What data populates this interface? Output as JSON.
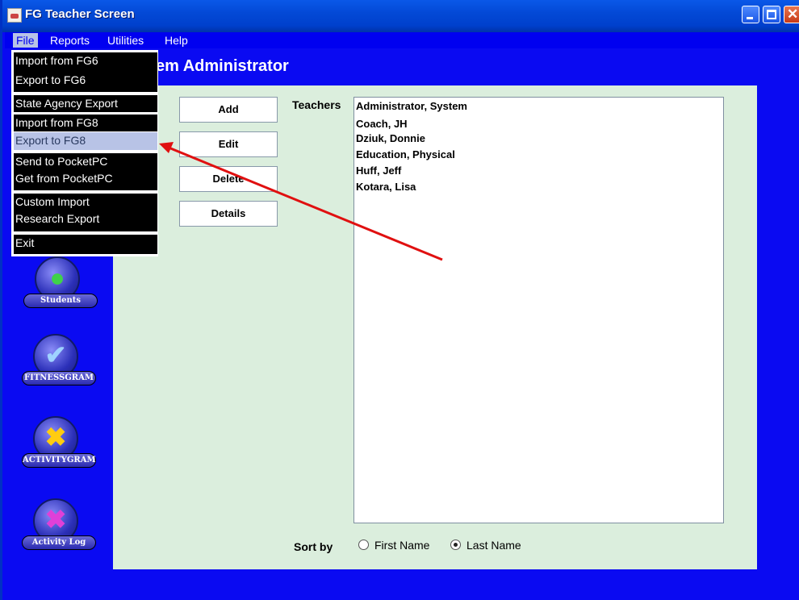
{
  "window": {
    "title": "FG Teacher Screen"
  },
  "menubar": {
    "items": [
      "File",
      "Reports",
      "Utilities",
      "Help"
    ]
  },
  "file_menu": {
    "items": [
      "Import from FG6",
      "Export to FG6",
      "State Agency Export",
      "Import from FG8",
      "Export to FG8",
      "Send to PocketPC",
      "Get from PocketPC",
      "Custom Import",
      "Research Export",
      "Exit"
    ],
    "highlighted": "Export to FG8"
  },
  "heading": "em Administrator",
  "buttons": {
    "add": "Add",
    "edit": "Edit",
    "delete": "Delete",
    "details": "Details"
  },
  "teachers": {
    "label": "Teachers",
    "items": [
      "Administrator, System",
      "Coach, JH",
      "Dziuk, Donnie",
      "Education, Physical",
      "Huff, Jeff",
      "Kotara, Lisa"
    ]
  },
  "sort": {
    "label": "Sort by",
    "first_name": "First Name",
    "last_name": "Last Name",
    "selected": "Last Name"
  },
  "sidebar": {
    "items": [
      {
        "label": "Students",
        "icon": "students-icon"
      },
      {
        "label": "FITNESSGRAM",
        "icon": "fitnessgram-icon"
      },
      {
        "label": "ACTIVITYGRAM",
        "icon": "activitygram-icon"
      },
      {
        "label": "Activity Log",
        "icon": "activity-log-icon"
      }
    ]
  },
  "colors": {
    "background": "#0000f0",
    "panel": "#dbeedd",
    "menu_highlight": "#b8c3e6",
    "annotation_arrow": "#e01010"
  }
}
